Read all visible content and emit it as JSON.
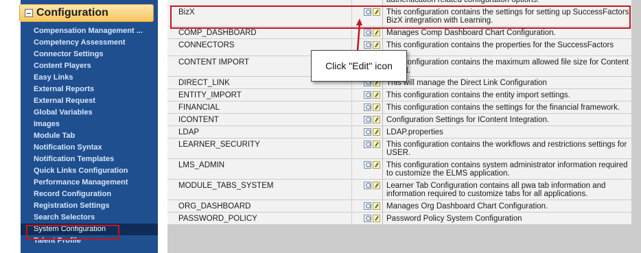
{
  "sidebar": {
    "section_title": "Configuration",
    "items": [
      {
        "label": "Compensation Management ...",
        "selected": false
      },
      {
        "label": "Competency Assessment",
        "selected": false
      },
      {
        "label": "Connector Settings",
        "selected": false
      },
      {
        "label": "Content Players",
        "selected": false
      },
      {
        "label": "Easy Links",
        "selected": false
      },
      {
        "label": "External Reports",
        "selected": false
      },
      {
        "label": "External Request",
        "selected": false
      },
      {
        "label": "Global Variables",
        "selected": false
      },
      {
        "label": "Images",
        "selected": false
      },
      {
        "label": "Module Tab",
        "selected": false
      },
      {
        "label": "Notification Syntax",
        "selected": false
      },
      {
        "label": "Notification Templates",
        "selected": false
      },
      {
        "label": "Quick Links Configuration",
        "selected": false
      },
      {
        "label": "Performance Management",
        "selected": false
      },
      {
        "label": "Record Configuration",
        "selected": false
      },
      {
        "label": "Registration Settings",
        "selected": false
      },
      {
        "label": "Search Selectors",
        "selected": false
      },
      {
        "label": "System Configuration",
        "selected": true
      },
      {
        "label": "Talent Profile",
        "selected": false
      }
    ]
  },
  "table": {
    "rows": [
      {
        "name": "",
        "desc": "authentication related configuration options."
      },
      {
        "name": "BizX",
        "desc": "This configuration contains the settings for setting up SuccessFactors BizX integration with Learning."
      },
      {
        "name": "COMP_DASHBOARD",
        "desc": "Manages Comp Dashboard Chart Configuration."
      },
      {
        "name": "CONNECTORS",
        "desc": "This configuration contains the properties for the SuccessFactors"
      },
      {
        "name": "CONTENT IMPORT",
        "desc": "This configuration contains the maximum allowed file size for Content import."
      },
      {
        "name": "DIRECT_LINK",
        "desc": "This will manage the Direct Link Configuration"
      },
      {
        "name": "ENTITY_IMPORT",
        "desc": "This configuration contains the entity import settings."
      },
      {
        "name": "FINANCIAL",
        "desc": "This configuration contains the settings for the financial framework."
      },
      {
        "name": "ICONTENT",
        "desc": "Configuration Settings for IContent Integration."
      },
      {
        "name": "LDAP",
        "desc": "LDAP.properties"
      },
      {
        "name": "LEARNER_SECURITY",
        "desc": "This configuration contains the workflows and restrictions settings for USER."
      },
      {
        "name": "LMS_ADMIN",
        "desc": "This configuration contains system administrator information required to customize the ELMS application."
      },
      {
        "name": "MODULE_TABS_SYSTEM",
        "desc": "Learner Tab Configuration contains all pwa tab information and information required to customize tabs for all applications."
      },
      {
        "name": "ORG_DASHBOARD",
        "desc": "Manages Org Dashboard Chart Configuration."
      },
      {
        "name": "PASSWORD_POLICY",
        "desc": "Password Policy System Configuration"
      }
    ]
  },
  "callout": {
    "text": "Click \"Edit\" icon"
  },
  "colors": {
    "highlight": "#c4161c",
    "sidebar_bg": "#1f4f8f",
    "section_header": "#f6c65b"
  }
}
